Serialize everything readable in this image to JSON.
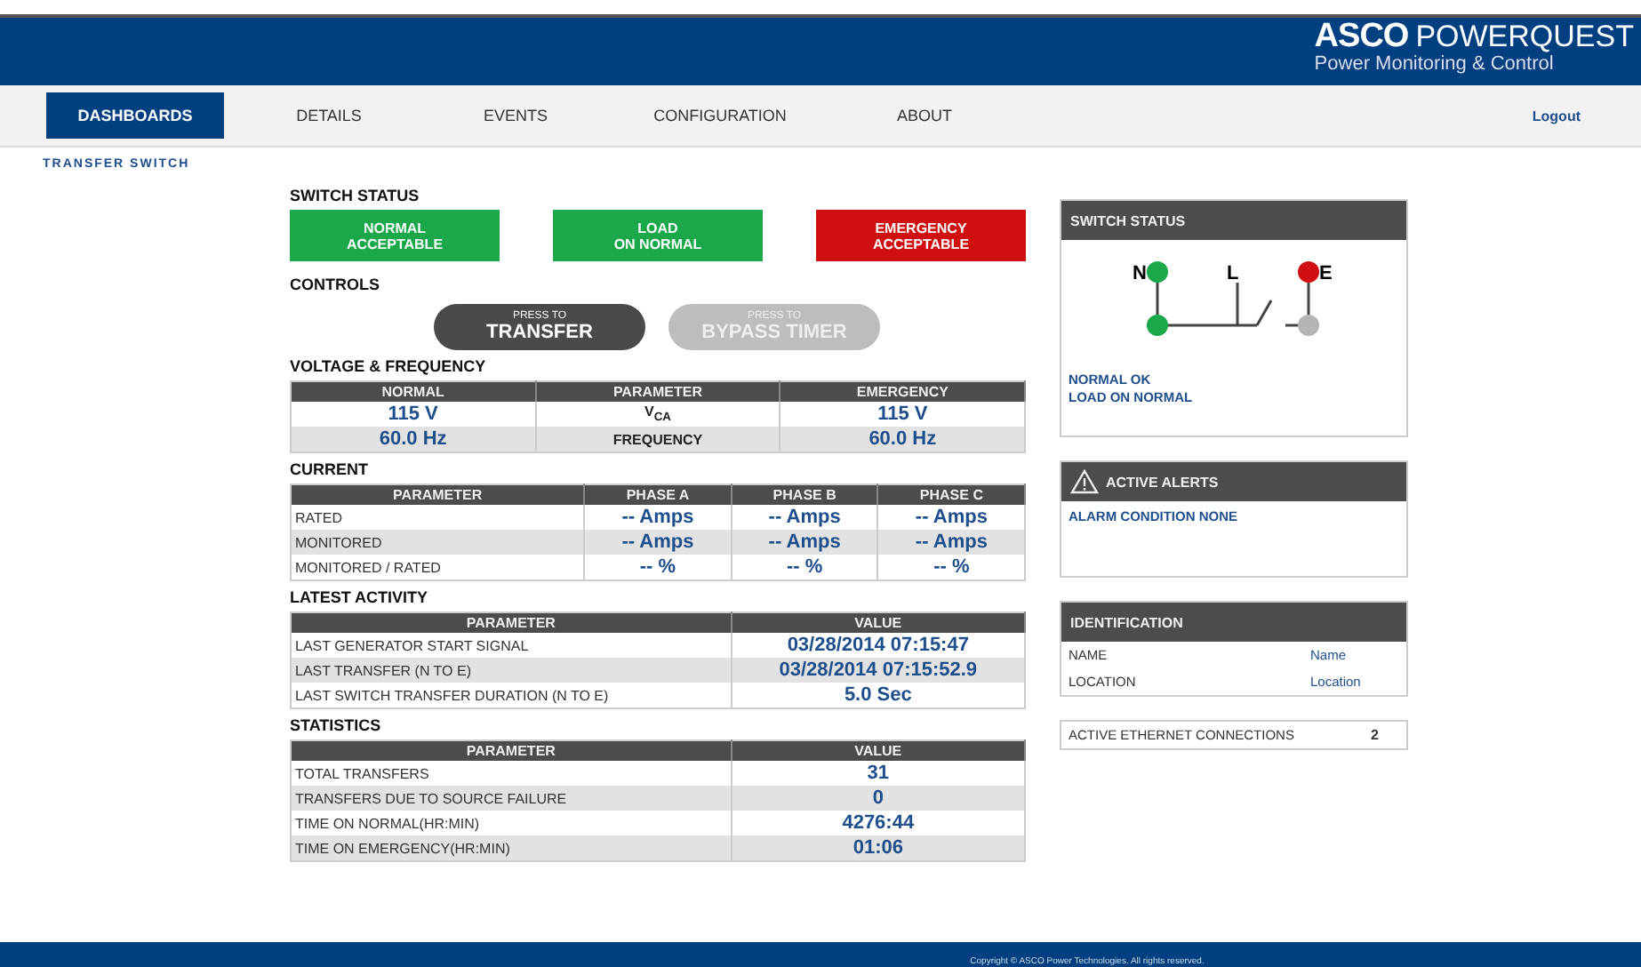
{
  "header": {
    "brand": "ASCO",
    "product": "POWERQUEST",
    "tagline": "Power Monitoring & Control"
  },
  "nav": {
    "items": [
      {
        "label": "DASHBOARDS",
        "selected": true
      },
      {
        "label": "DETAILS",
        "selected": false
      },
      {
        "label": "EVENTS",
        "selected": false
      },
      {
        "label": "CONFIGURATION",
        "selected": false
      },
      {
        "label": "ABOUT",
        "selected": false
      }
    ],
    "logout": "Logout"
  },
  "breadcrumb": "TRANSFER SWITCH",
  "switch_status": {
    "title": "SWITCH STATUS",
    "tiles": [
      {
        "lines": [
          "NORMAL",
          "ACCEPTABLE"
        ],
        "color": "#1aa84a"
      },
      {
        "lines": [
          "LOAD",
          "ON NORMAL"
        ],
        "color": "#1aa84a"
      },
      {
        "lines": [
          "EMERGENCY",
          "ACCEPTABLE"
        ],
        "color": "#d01010"
      }
    ]
  },
  "controls": {
    "title": "CONTROLS",
    "buttons": [
      {
        "prefix": "PRESS TO",
        "label": "TRANSFER",
        "disabled": false
      },
      {
        "prefix": "PRESS TO",
        "label": "BYPASS TIMER",
        "disabled": true
      }
    ]
  },
  "voltage": {
    "title": "VOLTAGE & FREQUENCY",
    "columns": [
      "NORMAL",
      "PARAMETER",
      "EMERGENCY"
    ],
    "rows": [
      [
        "115 V",
        "V$_{CA}$",
        "115 V"
      ],
      [
        "60.0 Hz",
        "FREQUENCY",
        "60.0 Hz"
      ]
    ]
  },
  "current": {
    "title": "CURRENT",
    "columns": [
      "PARAMETER",
      "PHASE A",
      "PHASE B",
      "PHASE C"
    ],
    "rows": [
      [
        "RATED",
        "-- Amps",
        "-- Amps",
        "-- Amps"
      ],
      [
        "MONITORED",
        "-- Amps",
        "-- Amps",
        "-- Amps"
      ],
      [
        "MONITORED / RATED",
        "-- %",
        "-- %",
        "-- %"
      ]
    ]
  },
  "activity": {
    "title": "LATEST ACTIVITY",
    "columns": [
      "PARAMETER",
      "VALUE"
    ],
    "rows": [
      [
        "LAST GENERATOR START SIGNAL",
        "03/28/2014 07:15:47"
      ],
      [
        "LAST TRANSFER (N TO E)",
        "03/28/2014 07:15:52.9"
      ],
      [
        "LAST SWITCH TRANSFER DURATION (N TO E)",
        "5.0 Sec"
      ]
    ]
  },
  "statistics": {
    "title": "STATISTICS",
    "columns": [
      "PARAMETER",
      "VALUE"
    ],
    "rows": [
      [
        "TOTAL TRANSFERS",
        "31"
      ],
      [
        "TRANSFERS DUE TO SOURCE FAILURE",
        "0"
      ],
      [
        "TIME ON NORMAL(HR:MIN)",
        "4276:44"
      ],
      [
        "TIME ON EMERGENCY(HR:MIN)",
        "01:06"
      ]
    ]
  },
  "side": {
    "switch_panel": {
      "title": "SWITCH STATUS",
      "labels": {
        "normal": "N",
        "load": "L",
        "emergency": "E"
      },
      "messages": [
        "NORMAL OK",
        "LOAD ON NORMAL"
      ]
    },
    "alerts": {
      "title": "ACTIVE ALERTS",
      "messages": [
        "ALARM CONDITION NONE"
      ]
    },
    "identification": {
      "title": "IDENTIFICATION",
      "rows": [
        [
          "NAME",
          "Name"
        ],
        [
          "LOCATION",
          "Location"
        ]
      ]
    },
    "ethernet": {
      "label": "ACTIVE ETHERNET CONNECTIONS",
      "value": "2"
    }
  },
  "footer": "Copyright © ASCO Power Technologies. All rights reserved."
}
